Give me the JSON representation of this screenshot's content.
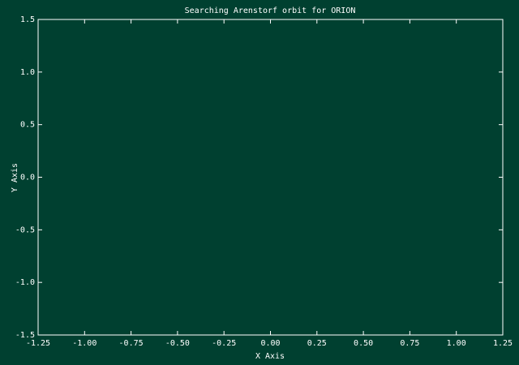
{
  "colors": {
    "background": "#004030",
    "axis": "#ffffff",
    "text": "#ffffff"
  },
  "chart_data": {
    "type": "line",
    "title": "Searching Arenstorf orbit for ORION",
    "xlabel": "X Axis",
    "ylabel": "Y Axis",
    "xlim": [
      -1.25,
      1.25
    ],
    "ylim": [
      -1.5,
      1.5
    ],
    "xticks": [
      -1.25,
      -1.0,
      -0.75,
      -0.5,
      -0.25,
      0.0,
      0.25,
      0.5,
      0.75,
      1.0,
      1.25
    ],
    "yticks": [
      -1.5,
      -1.0,
      -0.5,
      0.0,
      0.5,
      1.0,
      1.5
    ],
    "xtick_labels": [
      "-1.25",
      "-1.00",
      "-0.75",
      "-0.50",
      "-0.25",
      "0.00",
      "0.25",
      "0.50",
      "0.75",
      "1.00",
      "1.25"
    ],
    "ytick_labels": [
      "-1.5",
      "-1.0",
      "-0.5",
      "0.0",
      "0.5",
      "1.0",
      "1.5"
    ],
    "grid": false,
    "series": []
  }
}
